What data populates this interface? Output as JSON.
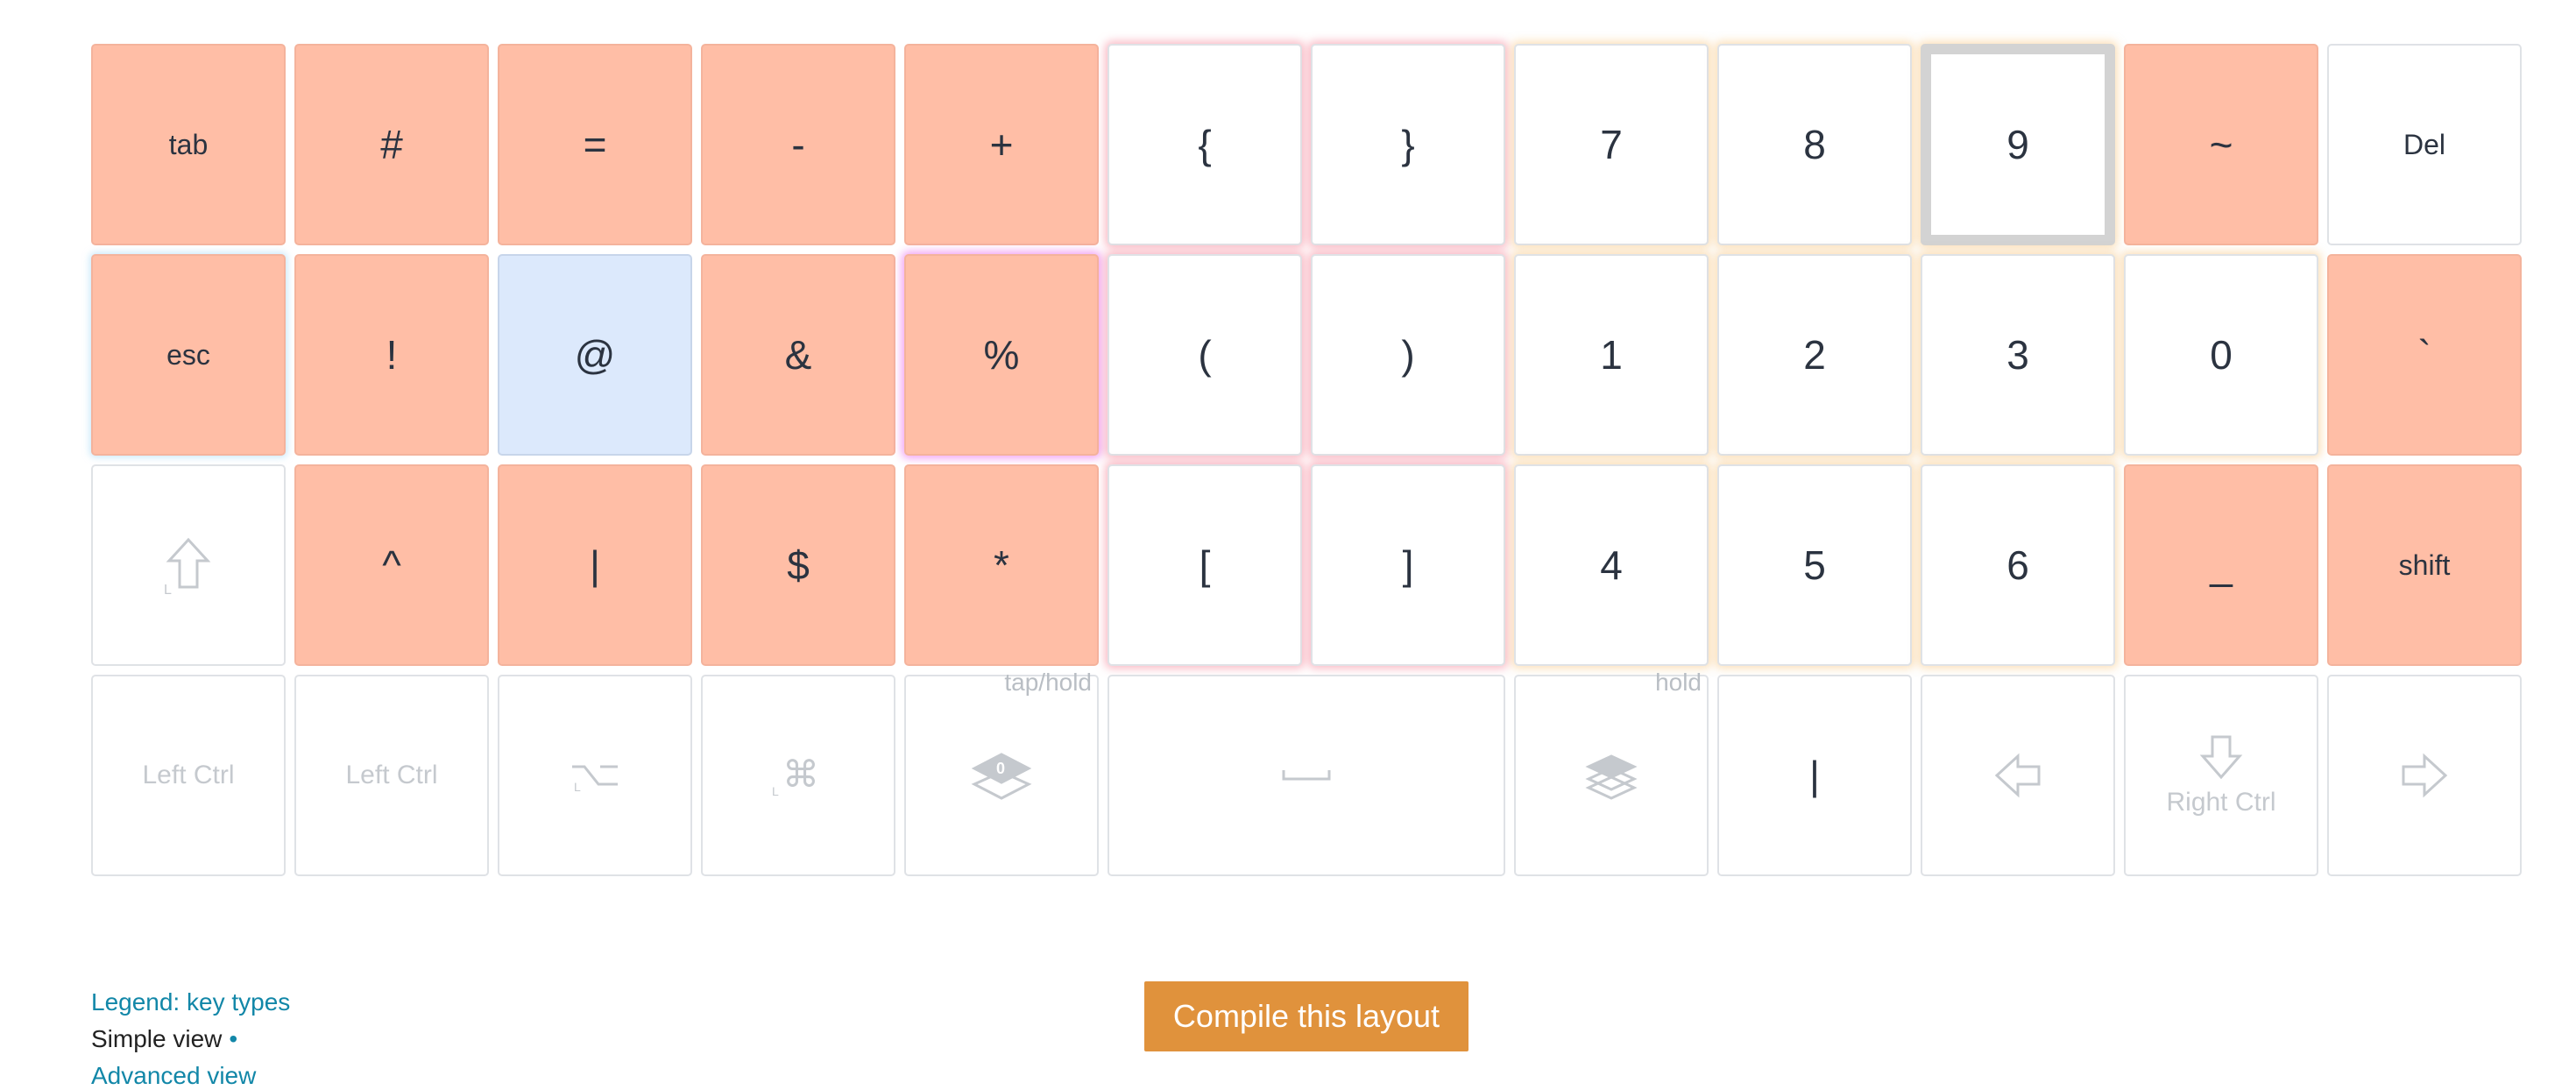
{
  "row1": [
    "tab",
    "#",
    "=",
    "-",
    "+",
    "{",
    "}",
    "7",
    "8",
    "9",
    "~",
    "Del"
  ],
  "row2": [
    "esc",
    "!",
    "@",
    "&",
    "%",
    "(",
    ")",
    "1",
    "2",
    "3",
    "0",
    "`"
  ],
  "row3": [
    "",
    "^",
    "|",
    "$",
    "*",
    "[",
    "]",
    "4",
    "5",
    "6",
    "_",
    "shift"
  ],
  "row4": {
    "left_ctrl_1": "Left Ctrl",
    "left_ctrl_2": "Left Ctrl",
    "tap_hold_note": "tap/hold",
    "layer_number": "0",
    "hold_note": "hold",
    "pipe": "|",
    "right_ctrl": "Right Ctrl"
  },
  "icons": {
    "shift": "shift-arrow-icon",
    "alt": "option-icon",
    "cmd": "command-icon",
    "layer": "layers-icon",
    "space": "spacebar-icon",
    "left": "arrow-left-icon",
    "down": "arrow-down-icon",
    "right": "arrow-right-icon"
  },
  "colors": {
    "modified_key": "#ffbea6",
    "selected_key": "#dce9fc",
    "link": "#1287a8",
    "compile_button": "#e0923c"
  },
  "footer": {
    "legend": "Legend: key types",
    "simple_view": "Simple view",
    "simple_dot": "•",
    "advanced_view": "Advanced view"
  },
  "compile_label": "Compile this layout"
}
